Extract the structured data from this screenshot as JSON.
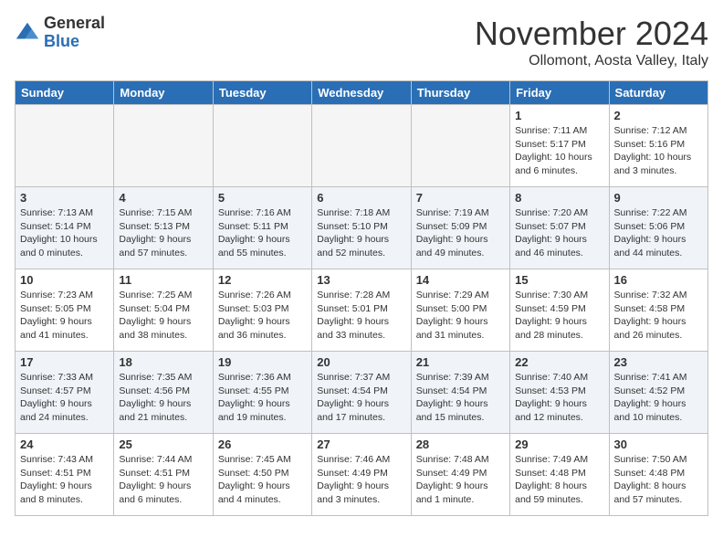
{
  "logo": {
    "general": "General",
    "blue": "Blue"
  },
  "header": {
    "month": "November 2024",
    "location": "Ollomont, Aosta Valley, Italy"
  },
  "weekdays": [
    "Sunday",
    "Monday",
    "Tuesday",
    "Wednesday",
    "Thursday",
    "Friday",
    "Saturday"
  ],
  "weeks": [
    [
      {
        "day": "",
        "info": ""
      },
      {
        "day": "",
        "info": ""
      },
      {
        "day": "",
        "info": ""
      },
      {
        "day": "",
        "info": ""
      },
      {
        "day": "",
        "info": ""
      },
      {
        "day": "1",
        "info": "Sunrise: 7:11 AM\nSunset: 5:17 PM\nDaylight: 10 hours\nand 6 minutes."
      },
      {
        "day": "2",
        "info": "Sunrise: 7:12 AM\nSunset: 5:16 PM\nDaylight: 10 hours\nand 3 minutes."
      }
    ],
    [
      {
        "day": "3",
        "info": "Sunrise: 7:13 AM\nSunset: 5:14 PM\nDaylight: 10 hours\nand 0 minutes."
      },
      {
        "day": "4",
        "info": "Sunrise: 7:15 AM\nSunset: 5:13 PM\nDaylight: 9 hours\nand 57 minutes."
      },
      {
        "day": "5",
        "info": "Sunrise: 7:16 AM\nSunset: 5:11 PM\nDaylight: 9 hours\nand 55 minutes."
      },
      {
        "day": "6",
        "info": "Sunrise: 7:18 AM\nSunset: 5:10 PM\nDaylight: 9 hours\nand 52 minutes."
      },
      {
        "day": "7",
        "info": "Sunrise: 7:19 AM\nSunset: 5:09 PM\nDaylight: 9 hours\nand 49 minutes."
      },
      {
        "day": "8",
        "info": "Sunrise: 7:20 AM\nSunset: 5:07 PM\nDaylight: 9 hours\nand 46 minutes."
      },
      {
        "day": "9",
        "info": "Sunrise: 7:22 AM\nSunset: 5:06 PM\nDaylight: 9 hours\nand 44 minutes."
      }
    ],
    [
      {
        "day": "10",
        "info": "Sunrise: 7:23 AM\nSunset: 5:05 PM\nDaylight: 9 hours\nand 41 minutes."
      },
      {
        "day": "11",
        "info": "Sunrise: 7:25 AM\nSunset: 5:04 PM\nDaylight: 9 hours\nand 38 minutes."
      },
      {
        "day": "12",
        "info": "Sunrise: 7:26 AM\nSunset: 5:03 PM\nDaylight: 9 hours\nand 36 minutes."
      },
      {
        "day": "13",
        "info": "Sunrise: 7:28 AM\nSunset: 5:01 PM\nDaylight: 9 hours\nand 33 minutes."
      },
      {
        "day": "14",
        "info": "Sunrise: 7:29 AM\nSunset: 5:00 PM\nDaylight: 9 hours\nand 31 minutes."
      },
      {
        "day": "15",
        "info": "Sunrise: 7:30 AM\nSunset: 4:59 PM\nDaylight: 9 hours\nand 28 minutes."
      },
      {
        "day": "16",
        "info": "Sunrise: 7:32 AM\nSunset: 4:58 PM\nDaylight: 9 hours\nand 26 minutes."
      }
    ],
    [
      {
        "day": "17",
        "info": "Sunrise: 7:33 AM\nSunset: 4:57 PM\nDaylight: 9 hours\nand 24 minutes."
      },
      {
        "day": "18",
        "info": "Sunrise: 7:35 AM\nSunset: 4:56 PM\nDaylight: 9 hours\nand 21 minutes."
      },
      {
        "day": "19",
        "info": "Sunrise: 7:36 AM\nSunset: 4:55 PM\nDaylight: 9 hours\nand 19 minutes."
      },
      {
        "day": "20",
        "info": "Sunrise: 7:37 AM\nSunset: 4:54 PM\nDaylight: 9 hours\nand 17 minutes."
      },
      {
        "day": "21",
        "info": "Sunrise: 7:39 AM\nSunset: 4:54 PM\nDaylight: 9 hours\nand 15 minutes."
      },
      {
        "day": "22",
        "info": "Sunrise: 7:40 AM\nSunset: 4:53 PM\nDaylight: 9 hours\nand 12 minutes."
      },
      {
        "day": "23",
        "info": "Sunrise: 7:41 AM\nSunset: 4:52 PM\nDaylight: 9 hours\nand 10 minutes."
      }
    ],
    [
      {
        "day": "24",
        "info": "Sunrise: 7:43 AM\nSunset: 4:51 PM\nDaylight: 9 hours\nand 8 minutes."
      },
      {
        "day": "25",
        "info": "Sunrise: 7:44 AM\nSunset: 4:51 PM\nDaylight: 9 hours\nand 6 minutes."
      },
      {
        "day": "26",
        "info": "Sunrise: 7:45 AM\nSunset: 4:50 PM\nDaylight: 9 hours\nand 4 minutes."
      },
      {
        "day": "27",
        "info": "Sunrise: 7:46 AM\nSunset: 4:49 PM\nDaylight: 9 hours\nand 3 minutes."
      },
      {
        "day": "28",
        "info": "Sunrise: 7:48 AM\nSunset: 4:49 PM\nDaylight: 9 hours\nand 1 minute."
      },
      {
        "day": "29",
        "info": "Sunrise: 7:49 AM\nSunset: 4:48 PM\nDaylight: 8 hours\nand 59 minutes."
      },
      {
        "day": "30",
        "info": "Sunrise: 7:50 AM\nSunset: 4:48 PM\nDaylight: 8 hours\nand 57 minutes."
      }
    ]
  ]
}
